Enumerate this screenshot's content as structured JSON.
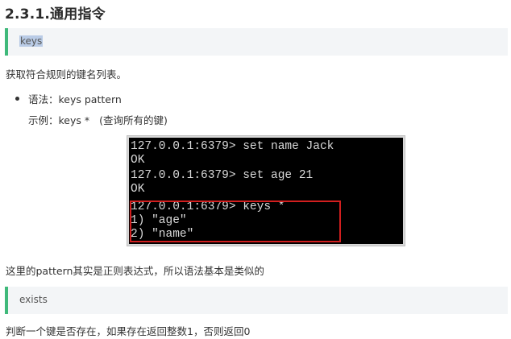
{
  "section": {
    "title": "2.3.1.通用指令"
  },
  "keys_block": {
    "command": "keys"
  },
  "keys_description": "获取符合规则的键名列表。",
  "syntax_line": "语法：keys pattern",
  "example": {
    "label": "示例：keys *",
    "note": "(查询所有的键)"
  },
  "terminal": {
    "lines": [
      "127.0.0.1:6379> set name Jack",
      "OK",
      "127.0.0.1:6379> set age 21",
      "OK",
      "127.0.0.1:6379> keys *",
      "1) \"age\"",
      "2) \"name\""
    ],
    "highlight_color": "#d21f1f",
    "background": "#000000",
    "text_color": "#d9d9d9"
  },
  "pattern_note": "这里的pattern其实是正则表达式，所以语法基本是类似的",
  "exists_block": {
    "command": "exists"
  },
  "exists_description": "判断一个键是否存在，如果存在返回整数1，否则返回0",
  "colors": {
    "accent_bar": "#3fb97a",
    "block_background": "#f3f5f7",
    "selection_highlight": "#b9cbe6"
  }
}
